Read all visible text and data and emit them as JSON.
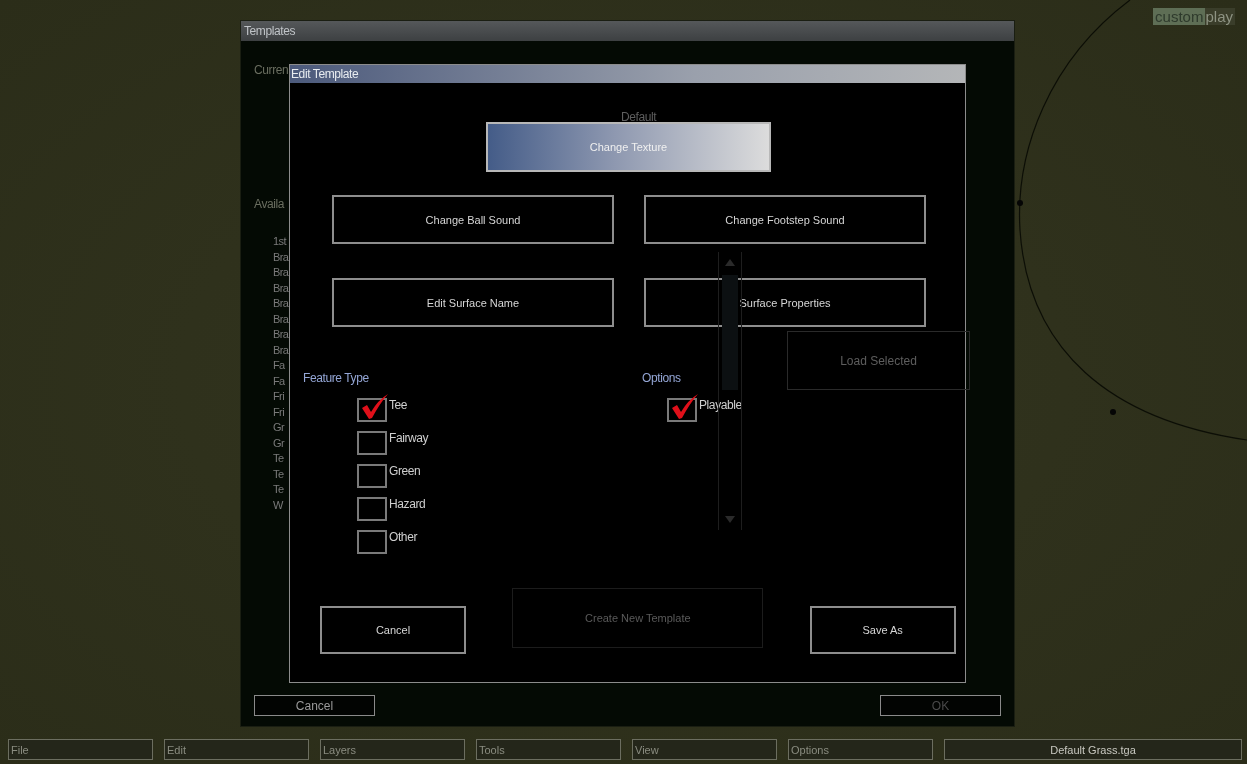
{
  "logo": {
    "highlight": "custom",
    "text": "play"
  },
  "templates_window": {
    "title": "Templates",
    "current_template_label": "Curren",
    "current_template": "Default",
    "available_templates_label": "Availa",
    "template_list": [
      "1st",
      "Bra",
      "Bra",
      "Bra",
      "Bra",
      "Bra",
      "Bra",
      "Bra",
      "Fa",
      "Fa",
      "Fri",
      "Fri",
      "Gr",
      "Gr",
      "Te",
      "Te",
      "Te",
      "W"
    ],
    "load_button": {
      "label": "Load Selected",
      "disabled": true
    },
    "buttons": [
      {
        "label": "Cancel",
        "disabled": false
      },
      {
        "label": "OK",
        "disabled": true
      }
    ]
  },
  "edit_template": {
    "title": "Edit Template",
    "texture_button": "Change Texture",
    "buttons": [
      "Change Ball Sound",
      "Change Footstep Sound",
      "Edit Surface Name",
      "Surface Properties"
    ],
    "feature_type": {
      "label": "Feature Type",
      "items": [
        {
          "label": "Tee",
          "checked": true
        },
        {
          "label": "Fairway",
          "checked": false
        },
        {
          "label": "Green",
          "checked": false
        },
        {
          "label": "Hazard",
          "checked": false
        },
        {
          "label": "Other",
          "checked": false
        }
      ]
    },
    "options": {
      "label": "Options",
      "items": [
        {
          "label": "Playable",
          "checked": true
        }
      ]
    },
    "footer_buttons": [
      {
        "label": "Cancel",
        "disabled": false
      },
      {
        "label": "Create New Template",
        "disabled": true
      },
      {
        "label": "Save As",
        "disabled": false
      }
    ]
  },
  "menu_bar": [
    "File",
    "Edit",
    "Layers",
    "Tools",
    "View",
    "Options"
  ],
  "texture_field": "Default Grass.tga"
}
